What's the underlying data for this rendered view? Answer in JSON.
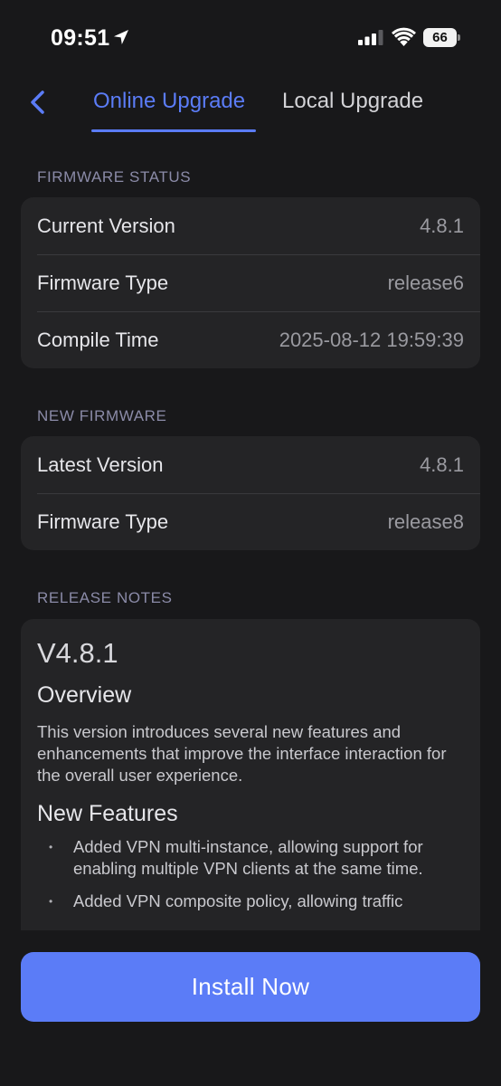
{
  "status_bar": {
    "time": "09:51",
    "battery_level": "66",
    "icons": [
      "location-arrow-icon",
      "cellular-signal-icon",
      "wifi-icon",
      "battery-icon"
    ]
  },
  "header": {
    "back_icon": "chevron-left-icon",
    "tabs": [
      {
        "label": "Online Upgrade",
        "active": true
      },
      {
        "label": "Local Upgrade",
        "active": false
      }
    ]
  },
  "firmware_status": {
    "section_label": "FIRMWARE STATUS",
    "rows": [
      {
        "label": "Current Version",
        "value": "4.8.1"
      },
      {
        "label": "Firmware Type",
        "value": "release6"
      },
      {
        "label": "Compile Time",
        "value": "2025-08-12 19:59:39"
      }
    ]
  },
  "new_firmware": {
    "section_label": "NEW FIRMWARE",
    "rows": [
      {
        "label": "Latest Version",
        "value": "4.8.1"
      },
      {
        "label": "Firmware Type",
        "value": "release8"
      }
    ]
  },
  "release_notes": {
    "section_label": "RELEASE NOTES",
    "version": "V4.8.1",
    "overview_heading": "Overview",
    "overview_text": "This version introduces several new features and enhancements that improve the interface interaction for the overall user experience.",
    "features_heading": "New Features",
    "features": [
      "Added VPN multi-instance, allowing support for enabling multiple VPN clients at the same time.",
      "Added VPN composite policy, allowing traffic"
    ]
  },
  "install_button": {
    "label": "Install Now"
  },
  "colors": {
    "accent": "#5b7cf7",
    "background": "#18181a",
    "card": "#242426",
    "section_label": "#8b8ba8"
  }
}
